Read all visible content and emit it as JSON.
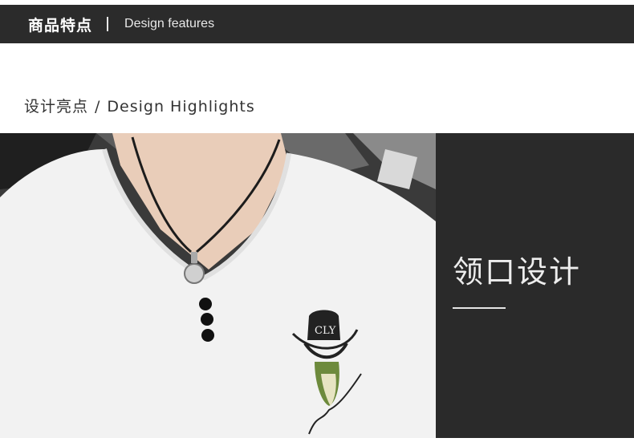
{
  "header": {
    "title_zh": "商品特点",
    "title_en": "Design features"
  },
  "section": {
    "title_zh": "设计亮点",
    "separator": "/",
    "title_en": "Design Highlights"
  },
  "panel": {
    "title": "领口设计"
  },
  "embroidery": {
    "hat_text": "CLY"
  },
  "colors": {
    "header_bg": "#2b2b2b",
    "panel_bg": "#2a2a2a",
    "shirt": "#f2f2f2"
  }
}
